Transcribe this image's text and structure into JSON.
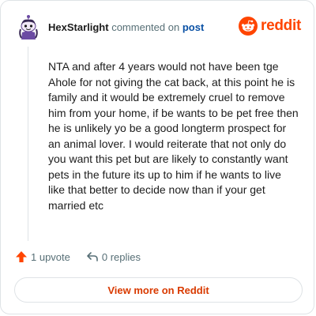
{
  "header": {
    "username": "HexStarlight",
    "action_text": "commented on",
    "post_link": "post",
    "avatar_icon": "snoo-avatar-icon"
  },
  "brand": {
    "wordmark": "reddit",
    "icon": "reddit-logo-icon",
    "color": "#ff4500"
  },
  "comment": {
    "body": "NTA and after 4 years would not have been tge Ahole for not giving the cat back, at this point he is family and it would be extremely cruel to remove him from your home, if be wants to be pet free then he is unlikely yo be a good longterm prospect for an animal lover. I would reiterate that not only do you want this pet but are likely to constantly want pets in the future its up to him if he wants to live like that better to decide now than if your get married etc"
  },
  "meta": {
    "upvotes": "1 upvote",
    "upvote_icon": "upvote-arrow-icon",
    "upvote_color": "#ff4500",
    "replies": "0 replies",
    "reply_icon": "reply-arrow-icon"
  },
  "footer": {
    "view_button": "View more on Reddit"
  }
}
